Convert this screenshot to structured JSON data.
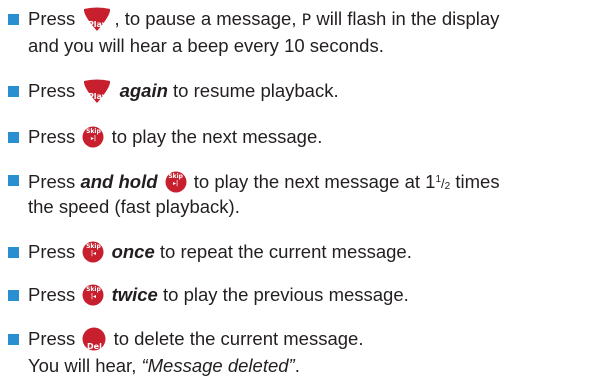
{
  "accent_color": "#2a8fd1",
  "button_color": "#c81f2e",
  "buttons": {
    "play_label": "Play",
    "skip_label": "Skip",
    "skip_next_glyph": "▸|",
    "skip_back_glyph": "|◂",
    "del_label": "Del"
  },
  "items": [
    {
      "press": "Press",
      "after": ", to pause a message,",
      "flash_char": "P",
      "after2": "will flash in the display",
      "line2": "and you will hear a beep every 10 seconds."
    },
    {
      "press": "Press",
      "emphasis": "again",
      "after": "to resume playback."
    },
    {
      "press": "Press",
      "after": "to play the next message."
    },
    {
      "press": "Press",
      "emphasis": "and hold",
      "after": "to play the next message at 1",
      "frac_num": "1",
      "frac_sep": "/",
      "frac_den": "2",
      "after2": "times",
      "line2": "the speed (fast playback)."
    },
    {
      "press": "Press",
      "emphasis": "once",
      "after": "to repeat the current message."
    },
    {
      "press": "Press",
      "emphasis": "twice",
      "after": "to play the previous message."
    },
    {
      "press": "Press",
      "after": "to delete the current message.",
      "line2_prefix": "You will hear,",
      "line2_quote": "“Message deleted”",
      "line2_suffix": "."
    }
  ]
}
